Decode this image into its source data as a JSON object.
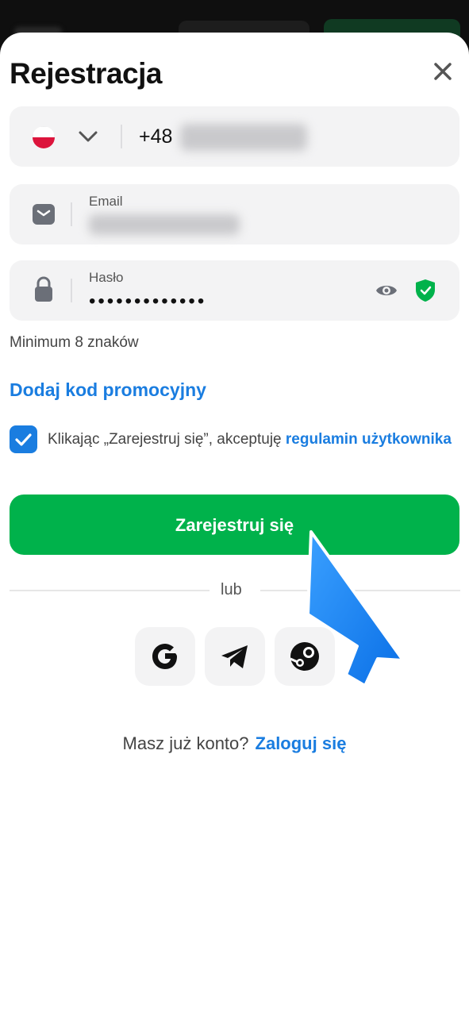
{
  "header": {
    "title": "Rejestracja"
  },
  "phone": {
    "country_flag": "poland-flag-icon",
    "prefix": "+48"
  },
  "email": {
    "label": "Email"
  },
  "password": {
    "label": "Hasło",
    "masked_value": "•••••••••••••",
    "hint": "Minimum 8 znaków"
  },
  "promo": {
    "label": "Dodaj kod promocyjny"
  },
  "terms": {
    "checked": true,
    "text": "Klikając „Zarejestruj się”, akceptuję ",
    "link": "regulamin użytkownika"
  },
  "actions": {
    "register_label": "Zarejestruj się",
    "or_label": "lub"
  },
  "social": [
    "google-icon",
    "telegram-icon",
    "steam-icon"
  ],
  "footer": {
    "question": "Masz już konto?",
    "login_link": "Zaloguj się"
  },
  "colors": {
    "accent": "#1a7de0",
    "primary_button": "#00b24b",
    "field_bg": "#f3f3f4",
    "shield": "#00b24b"
  }
}
